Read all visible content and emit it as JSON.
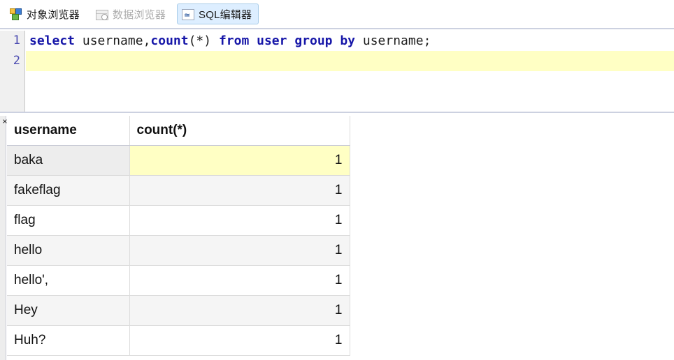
{
  "tabs": [
    {
      "label": "对象浏览器",
      "icon": "cubes-icon",
      "state": "normal"
    },
    {
      "label": "数据浏览器",
      "icon": "data-grid-icon",
      "state": "disabled"
    },
    {
      "label": "SQL编辑器",
      "icon": "sql-sheet-icon",
      "state": "selected"
    }
  ],
  "editor": {
    "lines": [
      {
        "number": "1",
        "highlighted": false,
        "tokens": [
          {
            "text": "select",
            "kind": "keyword"
          },
          {
            "text": " username,",
            "kind": "plain"
          },
          {
            "text": "count",
            "kind": "keyword"
          },
          {
            "text": "(*) ",
            "kind": "plain"
          },
          {
            "text": "from user group by",
            "kind": "keyword"
          },
          {
            "text": " username;",
            "kind": "plain"
          }
        ]
      },
      {
        "number": "2",
        "highlighted": true,
        "tokens": [
          {
            "text": "",
            "kind": "plain"
          }
        ]
      }
    ]
  },
  "results": {
    "close_label": "×",
    "columns": [
      "username",
      "count(*)"
    ],
    "rows": [
      {
        "username": "baka",
        "count": "1"
      },
      {
        "username": "fakeflag",
        "count": "1"
      },
      {
        "username": "flag",
        "count": "1"
      },
      {
        "username": "hello",
        "count": "1"
      },
      {
        "username": "hello',",
        "count": "1"
      },
      {
        "username": "Hey",
        "count": "1"
      },
      {
        "username": "Huh?",
        "count": "1"
      }
    ],
    "selected_cell": {
      "row": 0,
      "column": 1
    }
  },
  "colors": {
    "keyword": "#1616a8",
    "selection": "#ffffc4",
    "tab_selected_bg": "#ddeeff",
    "tab_selected_border": "#a9cce8",
    "divider": "#ccd1e0"
  }
}
